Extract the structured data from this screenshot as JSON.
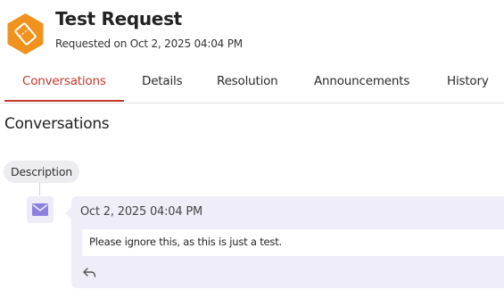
{
  "request": {
    "title": "Test Request",
    "subtitle": "Requested on Oct 2, 2025 04:04 PM",
    "icon": "ticket-hexagon-icon",
    "icon_color": "#f0931e"
  },
  "tabs": [
    {
      "label": "Conversations",
      "active": true
    },
    {
      "label": "Details",
      "active": false
    },
    {
      "label": "Resolution",
      "active": false
    },
    {
      "label": "Announcements",
      "active": false
    },
    {
      "label": "History",
      "active": false
    }
  ],
  "accent_color": "#c0392b",
  "section": {
    "title": "Conversations"
  },
  "thread": {
    "pill_label": "Description",
    "message": {
      "icon": "mail-icon",
      "date": "Oct 2, 2025 04:04 PM",
      "body": "Please ignore this, as this is just a test.",
      "reply_icon": "reply-icon"
    }
  }
}
